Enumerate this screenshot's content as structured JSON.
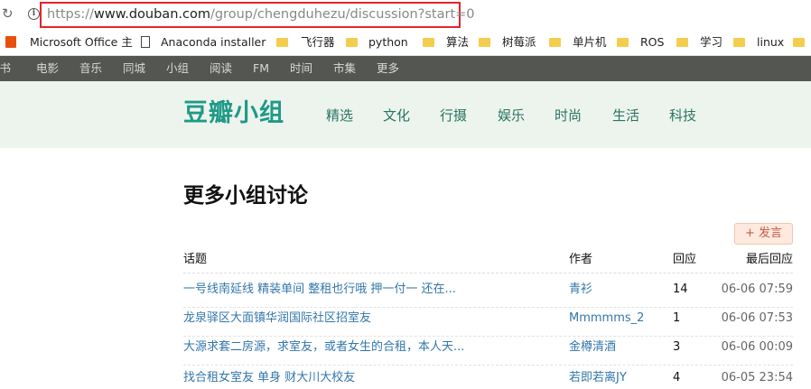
{
  "browser": {
    "url_prefix": "https://",
    "url_host": "www.douban.com",
    "url_path": "/group/chengduhezu/discussion?start=0",
    "bookmarks": [
      {
        "label": "Microsoft Office 主",
        "icon": "office-icon"
      },
      {
        "label": "Anaconda installer",
        "icon": "page-icon"
      },
      {
        "label": "飞行器",
        "icon": "folder-icon"
      },
      {
        "label": "python",
        "icon": "folder-icon"
      },
      {
        "label": "算法",
        "icon": "folder-icon"
      },
      {
        "label": "树莓派",
        "icon": "folder-icon"
      },
      {
        "label": "单片机",
        "icon": "folder-icon"
      },
      {
        "label": "ROS",
        "icon": "folder-icon"
      },
      {
        "label": "学习",
        "icon": "folder-icon"
      },
      {
        "label": "linux",
        "icon": "folder-icon"
      }
    ]
  },
  "topnav": {
    "items": [
      "读书",
      "电影",
      "音乐",
      "同城",
      "小组",
      "阅读",
      "FM",
      "时间",
      "市集",
      "更多"
    ]
  },
  "group_header": {
    "logo": "豆瓣小组",
    "nav": [
      "精选",
      "文化",
      "行摄",
      "娱乐",
      "时尚",
      "生活",
      "科技"
    ]
  },
  "main": {
    "title": "更多小组讨论",
    "post_button": "+ 发言",
    "columns": {
      "topic": "话题",
      "author": "作者",
      "replies": "回应",
      "last": "最后回应"
    },
    "rows": [
      {
        "topic": "一号线南延线 精装单间 整租也行哦 押一付一 还在...",
        "author": "青衫",
        "replies": "14",
        "last": "06-06 07:59"
      },
      {
        "topic": "龙泉驿区大面镇华润国际社区招室友",
        "author": "Mmmmms_2",
        "replies": "1",
        "last": "06-06 07:53"
      },
      {
        "topic": "大源求套二房源，求室友，或者女生的合租，本人天...",
        "author": "金樽清酒",
        "replies": "3",
        "last": "06-06 00:09"
      },
      {
        "topic": "找合租女室友 单身 财大川大校友",
        "author": "若即若离JY",
        "replies": "4",
        "last": "06-05 23:54"
      }
    ]
  },
  "colors": {
    "url_highlight": "#e5242b",
    "topnav_bg": "#545652",
    "header_bg": "#edf4ed",
    "logo": "#1f9a87",
    "link": "#3377aa",
    "post_btn_bg": "#fde9dd"
  }
}
